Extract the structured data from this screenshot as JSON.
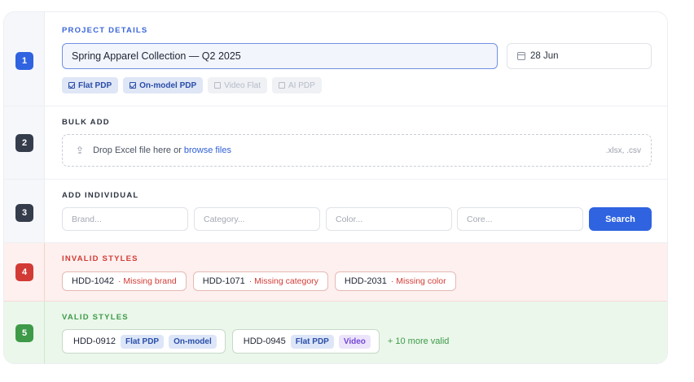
{
  "steps": [
    "1",
    "2",
    "3",
    "4",
    "5"
  ],
  "project": {
    "section_label": "PROJECT DETAILS",
    "name_value": "Spring Apparel Collection — Q2 2025",
    "date_value": "28 Jun",
    "chips": [
      {
        "label": "Flat PDP",
        "active": true
      },
      {
        "label": "On-model PDP",
        "active": true
      },
      {
        "label": "Video Flat",
        "active": false
      },
      {
        "label": "AI PDP",
        "active": false
      }
    ]
  },
  "bulk": {
    "section_label": "BULK ADD",
    "drop_text": "Drop Excel file here or",
    "browse_link": "browse files",
    "formats": ".xlsx, .csv"
  },
  "individual": {
    "section_label": "ADD INDIVIDUAL",
    "placeholders": [
      "Brand...",
      "Category...",
      "Color...",
      "Core..."
    ],
    "search_label": "Search"
  },
  "invalid": {
    "section_label": "INVALID STYLES",
    "items": [
      {
        "code": "HDD-1042",
        "error": "· Missing brand"
      },
      {
        "code": "HDD-1071",
        "error": "· Missing category"
      },
      {
        "code": "HDD-2031",
        "error": "· Missing color"
      }
    ]
  },
  "valid": {
    "section_label": "VALID STYLES",
    "items": [
      {
        "code": "HDD-0912",
        "tags": [
          "Flat PDP",
          "On-model"
        ]
      },
      {
        "code": "HDD-0945",
        "tags": [
          "Flat PDP",
          "Video"
        ]
      }
    ],
    "more_text": "+ 10 more valid"
  },
  "colors": {
    "accent": "#2f63e0",
    "error": "#d23b35",
    "success": "#3e9a48",
    "video_tag": "#7547d4"
  },
  "icons": [
    "calendar-icon",
    "checkbox-icon",
    "upload-icon"
  ]
}
